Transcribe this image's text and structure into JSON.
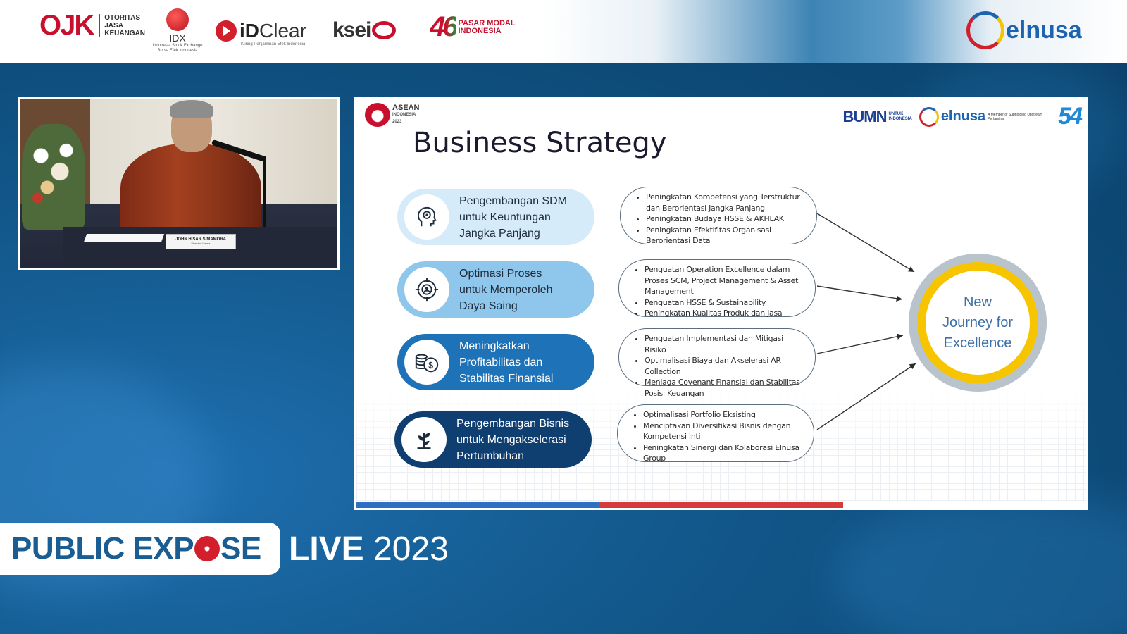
{
  "header": {
    "ojk": {
      "mark": "OJK",
      "lines": [
        "OTORITAS",
        "JASA",
        "KEUANGAN"
      ]
    },
    "idx": {
      "name": "IDX",
      "sub": "Indonesia Stock Exchange Bursa Efek Indonesia"
    },
    "idclear": {
      "name_bold": "iD",
      "name_rest": "Clear",
      "sub": "Kliring Penjaminan Efek Indonesia"
    },
    "ksei": {
      "name": "ksei"
    },
    "pasar_modal": {
      "number": "46",
      "line1": "PASAR MODAL",
      "line2": "INDONESIA"
    },
    "elnusa": {
      "name": "elnusa"
    }
  },
  "camera": {
    "nameplate_name": "JOHN HISAR SIMAMORA",
    "nameplate_role": "Direktur Utama"
  },
  "slide": {
    "asean": {
      "name": "ASEAN",
      "line2": "INDONESIA",
      "line3": "2023"
    },
    "bumn": {
      "name": "BUMN",
      "sub1": "UNTUK",
      "sub2": "INDONESIA"
    },
    "elnusa": {
      "name": "elnusa",
      "sub": "A Member of Subholding Upstream Pertamina"
    },
    "anniv": {
      "number": "54"
    },
    "title": "Business Strategy",
    "pillars": [
      {
        "label": "Pengembangan SDM\nuntuk Keuntungan\nJangka Panjang",
        "icon": "head-gear-icon",
        "bg": "#d6ebf9",
        "fg": "#1d2b3a"
      },
      {
        "label": "Optimasi Proses\nuntuk Memperoleh\nDaya Saing",
        "icon": "target-person-icon",
        "bg": "#8fc6ec",
        "fg": "#1d2b3a"
      },
      {
        "label": "Meningkatkan\nProfitabilitas dan\nStabilitas Finansial",
        "icon": "coins-dollar-icon",
        "bg": "#1e72b8",
        "fg": "#ffffff"
      },
      {
        "label": "Pengembangan Bisnis\nuntuk Mengakselerasi\nPertumbuhan",
        "icon": "plant-sprout-icon",
        "bg": "#0f3e70",
        "fg": "#ffffff"
      }
    ],
    "bullets": [
      [
        "Peningkatan Kompetensi yang Terstruktur dan Berorientasi Jangka Panjang",
        "Peningkatan Budaya HSSE & AKHLAK",
        "Peningkatan Efektifitas Organisasi Berorientasi Data"
      ],
      [
        "Penguatan Operation Excellence dalam Proses SCM, Project Management & Asset Management",
        "Penguatan HSSE & Sustainability",
        "Peningkatan Kualitas Produk dan Jasa"
      ],
      [
        "Penguatan Implementasi dan Mitigasi Risiko",
        "Optimalisasi Biaya dan Akselerasi AR Collection",
        "Menjaga Covenant Finansial dan Stabilitas Posisi Keuangan"
      ],
      [
        "Optimalisasi Portfolio Eksisting",
        "Menciptakan Diversifikasi Bisnis dengan Kompetensi Inti",
        "Peningkatan Sinergi dan Kolaborasi Elnusa Group"
      ]
    ],
    "goal": "New\nJourney for\nExcellence",
    "colors": {
      "bar_blue": "#2f6fc3",
      "bar_red": "#d63a3a",
      "bar_white": "#ffffff",
      "ring_yellow": "#f6c500"
    }
  },
  "footer": {
    "brand_part1": "PUBLIC EXP",
    "brand_part2": "SE",
    "live": "LIVE",
    "year": "2023"
  }
}
